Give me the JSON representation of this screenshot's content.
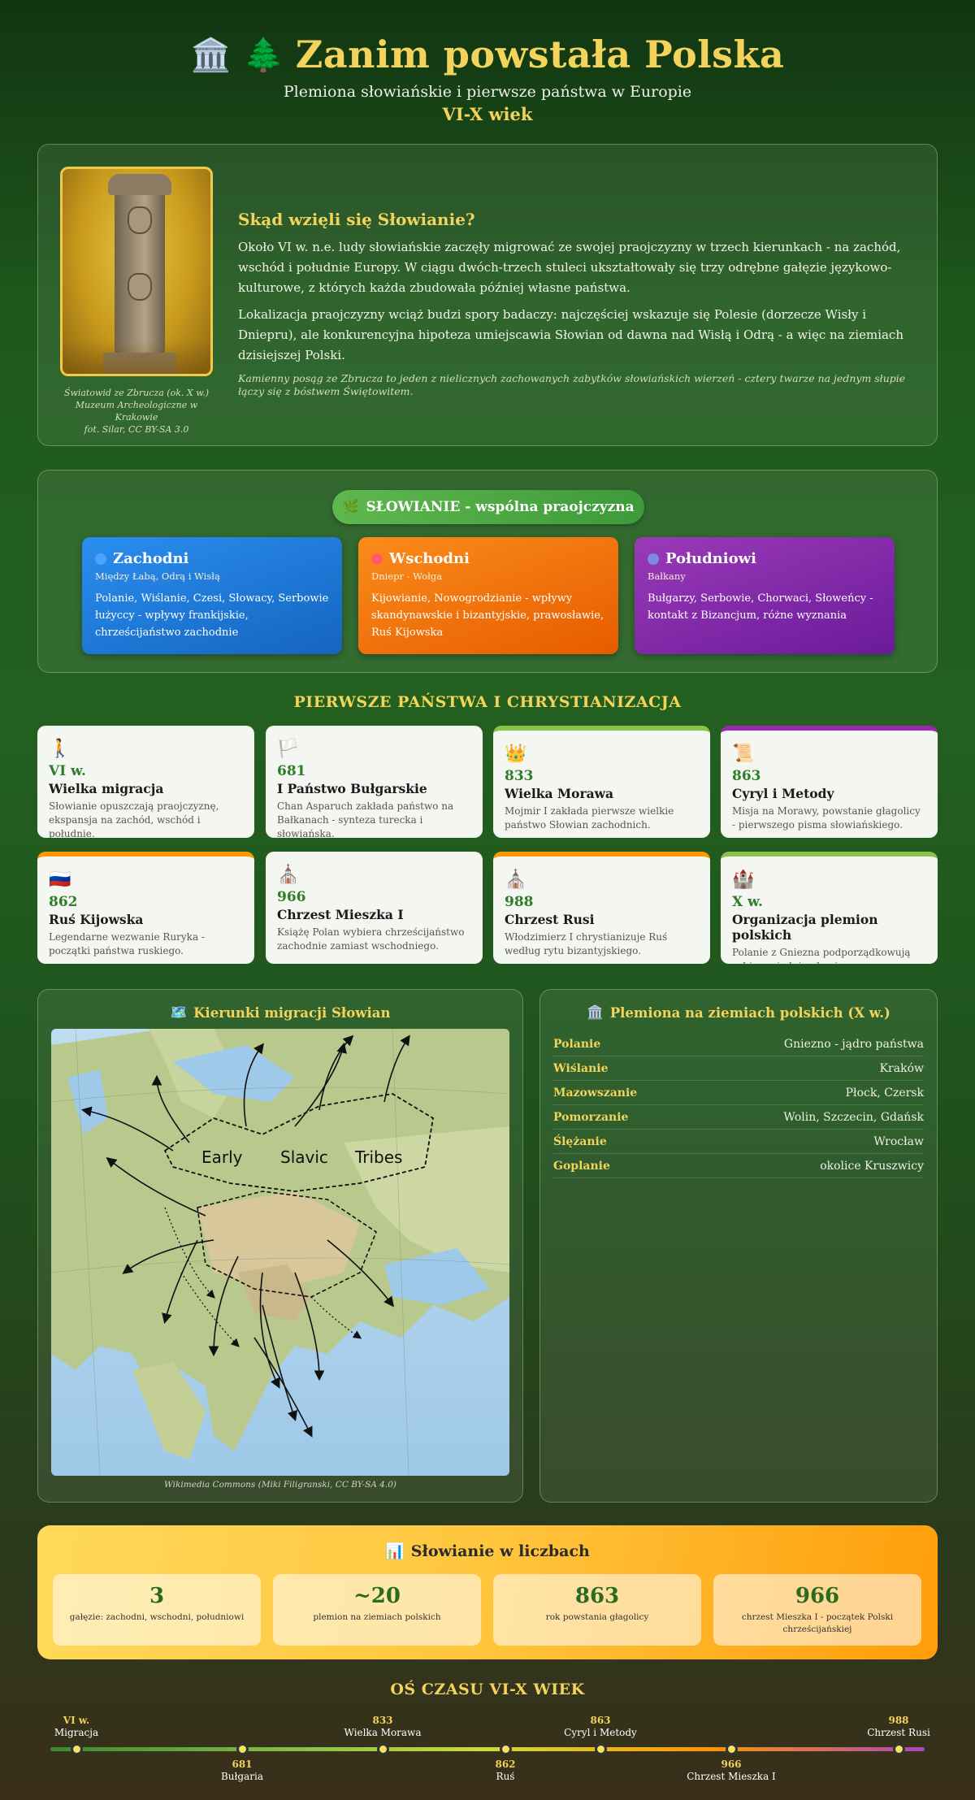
{
  "header": {
    "icons": "🏛️ 🌲",
    "title": "Zanim powstała Polska",
    "subtitle": "Plemiona słowiańskie i pierwsze państwa w Europie",
    "century": "VI-X wiek"
  },
  "intro": {
    "image_caption_1": "Światowid ze Zbrucza (ok. X w.)",
    "image_caption_2": "Muzeum Archeologiczne w Krakowie",
    "image_caption_3": "fot. Silar, CC BY-SA 3.0",
    "heading": "Skąd wzięli się Słowianie?",
    "p1": "Około VI w. n.e. ludy słowiańskie zaczęły migrować ze swojej praojczyzny w trzech kierunkach - na zachód, wschód i południe Europy. W ciągu dwóch-trzech stuleci ukształtowały się trzy odrębne gałęzie językowo-kulturowe, z których każda zbudowała później własne państwa.",
    "p2": "Lokalizacja praojczyzny wciąż budzi spory badaczy: najczęściej wskazuje się Polesie (dorzecze Wisły i Dniepru), ale konkurencyjna hipoteza umiejscawia Słowian od dawna nad Wisłą i Odrą - a więc na ziemiach dzisiejszej Polski.",
    "note": "Kamienny posąg ze Zbrucza to jeden z nielicznych zachowanych zabytków słowiańskich wierzeń - cztery twarze na jednym słupie łączy się z bóstwem Świętowitem."
  },
  "tree": {
    "root_icon": "🌿",
    "root": "SŁOWIANIE - wspólna praojczyzna",
    "branches": [
      {
        "title": "Zachodni",
        "sub": "Między Łabą, Odrą i Wisłą",
        "desc": "Polanie, Wiślanie, Czesi, Słowacy, Serbowie łużyccy - wpływy frankijskie, chrześcijaństwo zachodnie",
        "dot": "#4aa3ff"
      },
      {
        "title": "Wschodni",
        "sub": "Dniepr - Wołga",
        "desc": "Kijowianie, Nowogrodzianie - wpływy skandynawskie i bizantyjskie, prawosławie, Ruś Kijowska",
        "dot": "#ff5a6e"
      },
      {
        "title": "Południowi",
        "sub": "Bałkany",
        "desc": "Bułgarzy, Serbowie, Chorwaci, Słoweńcy - kontakt z Bizancjum, różne wyznania",
        "dot": "#7b8ce0"
      }
    ]
  },
  "states": {
    "title": "PIERWSZE PAŃSTWA I CHRYSTIANIZACJA",
    "cards": [
      {
        "icon": "🚶",
        "year": "VI w.",
        "title": "Wielka migracja",
        "desc": "Słowianie opuszczają praojczyznę, ekspansja na zachód, wschód i południe."
      },
      {
        "icon": "🏳️",
        "year": "681",
        "title": "I Państwo Bułgarskie",
        "desc": "Chan Asparuch zakłada państwo na Bałkanach - synteza turecka i słowiańska."
      },
      {
        "icon": "👑",
        "year": "833",
        "title": "Wielka Morawa",
        "desc": "Mojmir I zakłada pierwsze wielkie państwo Słowian zachodnich."
      },
      {
        "icon": "📜",
        "year": "863",
        "title": "Cyryl i Metody",
        "desc": "Misja na Morawy, powstanie głagolicy - pierwszego pisma słowiańskiego."
      },
      {
        "icon": "🇷🇺",
        "year": "862",
        "title": "Ruś Kijowska",
        "desc": "Legendarne wezwanie Ruryka - początki państwa ruskiego."
      },
      {
        "icon": "⛪",
        "year": "966",
        "title": "Chrzest Mieszka I",
        "desc": "Książę Polan wybiera chrześcijaństwo zachodnie zamiast wschodniego."
      },
      {
        "icon": "⛪",
        "year": "988",
        "title": "Chrzest Rusi",
        "desc": "Włodzimierz I chrystianizuje Ruś według rytu bizantyjskiego."
      },
      {
        "icon": "🏰",
        "year": "X w.",
        "title": "Organizacja plemion polskich",
        "desc": "Polanie z Gniezna podporządkowują sobie sąsiednie plemiona."
      }
    ]
  },
  "map": {
    "icon": "🗺️",
    "title": "Kierunki migracji Słowian",
    "label_1": "Early",
    "label_2": "Slavic",
    "label_3": "Tribes",
    "caption": "Wikimedia Commons (Miki Filigranski, CC BY-SA 4.0)"
  },
  "tribes": {
    "icon": "🏛️",
    "title": "Plemiona na ziemiach polskich (X w.)",
    "rows": [
      {
        "name": "Polanie",
        "value": "Gniezno - jądro państwa"
      },
      {
        "name": "Wiślanie",
        "value": "Kraków"
      },
      {
        "name": "Mazowszanie",
        "value": "Płock, Czersk"
      },
      {
        "name": "Pomorzanie",
        "value": "Wolin, Szczecin, Gdańsk"
      },
      {
        "name": "Ślężanie",
        "value": "Wrocław"
      },
      {
        "name": "Goplanie",
        "value": "okolice Kruszwicy"
      }
    ]
  },
  "stats": {
    "icon": "📊",
    "title": "Słowianie w liczbach",
    "items": [
      {
        "value": "3",
        "label": "gałęzie: zachodni, wschodni, południowi"
      },
      {
        "value": "~20",
        "label": "plemion na ziemiach polskich"
      },
      {
        "value": "863",
        "label": "rok powstania głagolicy"
      },
      {
        "value": "966",
        "label": "chrzest Mieszka I - początek Polski chrześcijańskiej"
      }
    ]
  },
  "timeline": {
    "title": "OŚ CZASU VI-X WIEK",
    "events": [
      {
        "year": "VI w.",
        "label": "Migracja"
      },
      {
        "year": "681",
        "label": "Bułgaria"
      },
      {
        "year": "833",
        "label": "Wielka Morawa"
      },
      {
        "year": "862",
        "label": "Ruś"
      },
      {
        "year": "863",
        "label": "Cyryl i Metody"
      },
      {
        "year": "966",
        "label": "Chrzest Mieszka I"
      },
      {
        "year": "988",
        "label": "Chrzest Rusi"
      }
    ]
  }
}
